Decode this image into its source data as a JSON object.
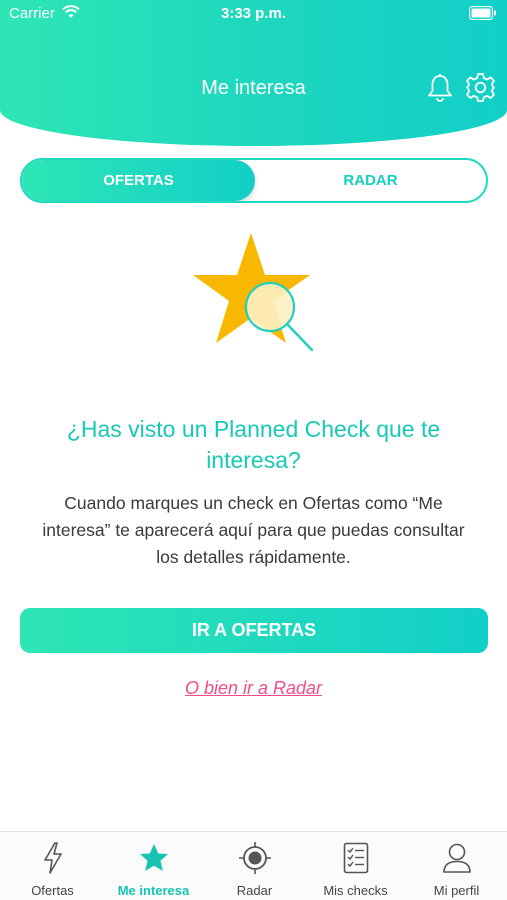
{
  "status_bar": {
    "carrier": "Carrier",
    "time": "3:33 p.m."
  },
  "header": {
    "title": "Me interesa"
  },
  "segmented": {
    "ofertas": "OFERTAS",
    "radar": "RADAR"
  },
  "empty_state": {
    "title": "¿Has visto un Planned Check que te interesa?",
    "body": "Cuando marques un check en Ofertas como “Me interesa” te aparecerá aquí para que puedas consultar los detalles rápidamente."
  },
  "actions": {
    "primary": "IR A OFERTAS",
    "secondary": "O bien ir a Radar"
  },
  "tabbar": {
    "items": [
      {
        "label": "Ofertas",
        "icon": "lightning-icon",
        "active": false
      },
      {
        "label": "Me interesa",
        "icon": "star-icon",
        "active": true
      },
      {
        "label": "Radar",
        "icon": "radar-icon",
        "active": false
      },
      {
        "label": "Mis checks",
        "icon": "checklist-icon",
        "active": false
      },
      {
        "label": "Mi perfil",
        "icon": "user-icon",
        "active": false
      }
    ]
  },
  "colors": {
    "brand": "#1fd8c2",
    "accent_link": "#ee4f86",
    "star": "#f9b800"
  }
}
